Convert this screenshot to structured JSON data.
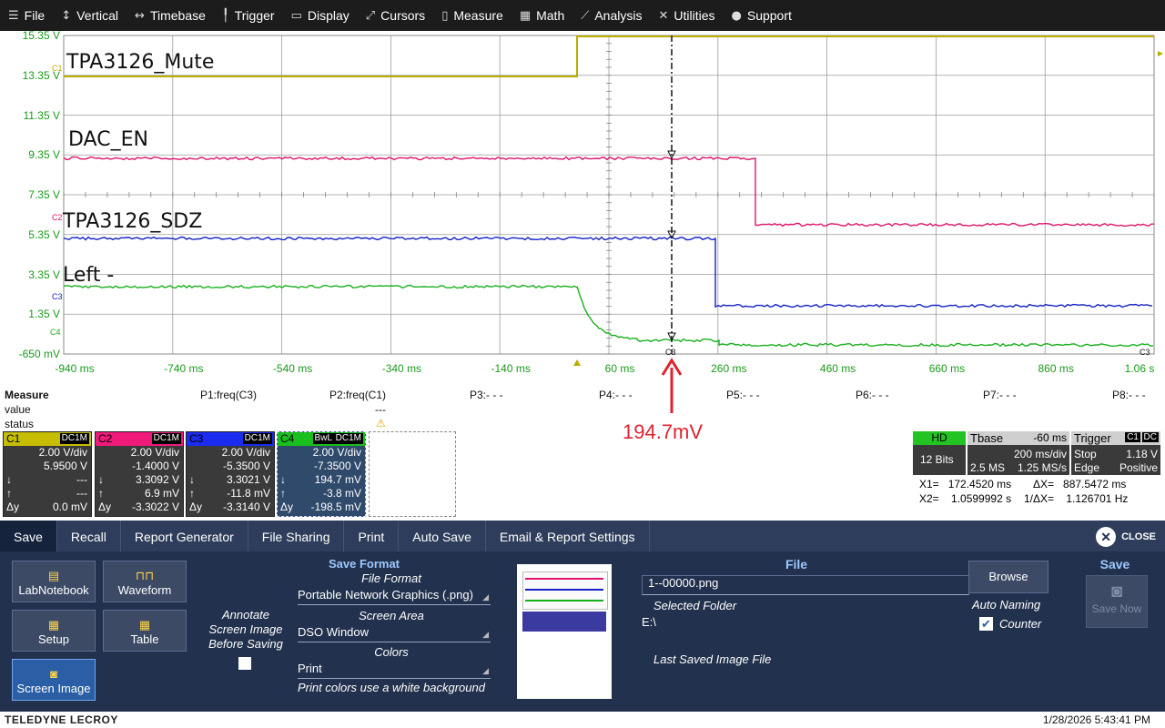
{
  "menubar": [
    {
      "label": "File",
      "icon": "file-icon",
      "glyph": "☰"
    },
    {
      "label": "Vertical",
      "icon": "vertical-icon",
      "glyph": "↕"
    },
    {
      "label": "Timebase",
      "icon": "timebase-icon",
      "glyph": "↔"
    },
    {
      "label": "Trigger",
      "icon": "trigger-icon",
      "glyph": "╿"
    },
    {
      "label": "Display",
      "icon": "display-icon",
      "glyph": "▭"
    },
    {
      "label": "Cursors",
      "icon": "cursors-icon",
      "glyph": "⤢"
    },
    {
      "label": "Measure",
      "icon": "measure-icon",
      "glyph": "▯"
    },
    {
      "label": "Math",
      "icon": "math-icon",
      "glyph": "▦"
    },
    {
      "label": "Analysis",
      "icon": "analysis-icon",
      "glyph": "⟋"
    },
    {
      "label": "Utilities",
      "icon": "utilities-icon",
      "glyph": "✕"
    },
    {
      "label": "Support",
      "icon": "support-icon",
      "glyph": "●"
    }
  ],
  "scope": {
    "vticks": [
      "15.35 V",
      "13.35 V",
      "11.35 V",
      "9.35 V",
      "7.35 V",
      "5.35 V",
      "3.35 V",
      "1.35 V",
      "-650 mV"
    ],
    "hticks": [
      "-940 ms",
      "-740 ms",
      "-540 ms",
      "-340 ms",
      "-140 ms",
      "60 ms",
      "260 ms",
      "460 ms",
      "660 ms",
      "860 ms",
      "1.06 s"
    ],
    "trace_labels": {
      "c1": "TPA3126_Mute",
      "c2": "DAC_EN",
      "c3": "TPA3126_SDZ",
      "c4": "Left -"
    },
    "channel_markers": [
      "C1",
      "C2",
      "C3",
      "C4"
    ],
    "cursor_label": "C3",
    "right_marker": "C3",
    "colors": {
      "c1": "#b8ae00",
      "c2": "#e0146c",
      "c3": "#1421c8",
      "c4": "#19b01d",
      "grid": "#9c9c9c",
      "axis": "#1a9a1a"
    },
    "annotation": "194.7mV"
  },
  "measure": {
    "title": "Measure",
    "row_value": "value",
    "row_status": "status",
    "params": [
      "P1:freq(C3)",
      "P2:freq(C1)",
      "P3:- - -",
      "P4:- - -",
      "P5:- - -",
      "P6:- - -",
      "P7:- - -",
      "P8:- - -"
    ],
    "p2_value": "---",
    "p2_status": "⚠"
  },
  "channels": [
    {
      "name": "C1",
      "coupling": "DC1M",
      "vdiv": "2.00 V/div",
      "offset": "5.9500 V",
      "down": "---",
      "up": "---",
      "dy": "0.0 mV",
      "color": "#c6bd00"
    },
    {
      "name": "C2",
      "coupling": "DC1M",
      "vdiv": "2.00 V/div",
      "offset": "-1.4000 V",
      "down": "3.3092 V",
      "up": "6.9 mV",
      "dy": "-3.3022 V",
      "color": "#ef1a7a"
    },
    {
      "name": "C3",
      "coupling": "DC1M",
      "vdiv": "2.00 V/div",
      "offset": "-5.3500 V",
      "down": "3.3021 V",
      "up": "-11.8 mV",
      "dy": "-3.3140 V",
      "color": "#1b2bf0"
    },
    {
      "name": "C4",
      "coupling": "DC1M",
      "bwl": "BwL",
      "vdiv": "2.00 V/div",
      "offset": "-7.3500 V",
      "down": "194.7 mV",
      "up": "-3.8 mV",
      "dy": "-198.5 mV",
      "color": "#19c01d"
    }
  ],
  "timebase": {
    "hd": "HD",
    "bits": "12 Bits",
    "tbase_label": "Tbase",
    "tbase_val": "-60 ms",
    "tdiv": "200 ms/div",
    "samples": "2.5 MS",
    "rate": "1.25 MS/s",
    "trig_label": "Trigger",
    "trig_ch": "C1",
    "trig_cp": "DC",
    "trig_mode": "Stop",
    "trig_level": "1.18 V",
    "trig_type": "Edge",
    "trig_slope": "Positive",
    "x1": "X1=   172.4520 ms",
    "dx": "ΔX=   887.5472 ms",
    "x2": "X2=    1.0599992 s",
    "inv": "1/ΔX=    1.126701 Hz"
  },
  "panel": {
    "tabs": [
      "Save",
      "Recall",
      "Report Generator",
      "File Sharing",
      "Print",
      "Auto Save",
      "Email & Report Settings"
    ],
    "close": "CLOSE",
    "buttons": [
      {
        "label": "LabNotebook",
        "icon": "labnotebook-icon",
        "glyph": "▤"
      },
      {
        "label": "Waveform",
        "icon": "waveform-icon",
        "glyph": "⊓⊓"
      },
      {
        "label": "Setup",
        "icon": "setup-icon",
        "glyph": "▦"
      },
      {
        "label": "Table",
        "icon": "table-icon",
        "glyph": "▦"
      },
      {
        "label": "Screen Image",
        "icon": "screen-image-icon",
        "glyph": "◙"
      }
    ],
    "annotate": "Annotate Screen Image Before Saving",
    "save_format": "Save Format",
    "file_format_label": "File Format",
    "file_format": "Portable Network Graphics (.png)",
    "screen_area_label": "Screen Area",
    "screen_area": "DSO Window",
    "colors_label": "Colors",
    "colors": "Print",
    "colors_note": "Print colors use a white background",
    "file_title": "File",
    "filename": "1--00000.png",
    "folder_label": "Selected Folder",
    "folder": "E:\\",
    "last_saved": "Last Saved Image File",
    "browse": "Browse",
    "auto_naming": "Auto Naming",
    "counter": "Counter",
    "save_title": "Save",
    "save_now": "Save Now"
  },
  "footer": {
    "brand": "TELEDYNE LECROY",
    "datetime": "1/28/2026 5:43:41 PM"
  }
}
